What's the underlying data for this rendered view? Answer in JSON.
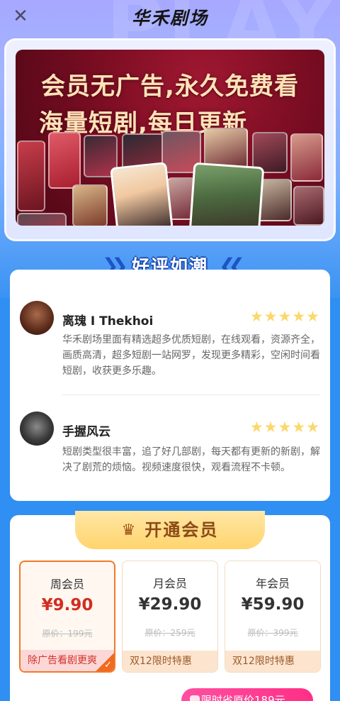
{
  "header": {
    "title": "华禾剧场",
    "close_icon": "close-icon"
  },
  "banner": {
    "line1": "会员无广告,永久免费看",
    "line2": "海量短剧,每日更新"
  },
  "reviews_section": {
    "title": "好评如潮",
    "items": [
      {
        "name": "离瑰 I Thekhoi",
        "stars": "★★★★★",
        "text": "华禾剧场里面有精选超多优质短剧，在线观看，资源齐全，画质高清，超多短剧一站网罗，发现更多精彩，空闲时间看短剧，收获更多乐趣。"
      },
      {
        "name": "手握风云",
        "stars": "★★★★★",
        "text": "短剧类型很丰富，追了好几部剧，每天都有更新的新剧，解决了剧荒的烦恼。视频速度很快，观看流程不卡顿。"
      }
    ]
  },
  "membership": {
    "title": "开通会员",
    "plans": [
      {
        "name": "周会员",
        "price": "¥9.90",
        "original": "原价：199元",
        "promo": "除广告看剧更爽",
        "selected": true
      },
      {
        "name": "月会员",
        "price": "¥29.90",
        "original": "原价：259元",
        "promo": "双12限时特惠",
        "selected": false
      },
      {
        "name": "年会员",
        "price": "¥59.90",
        "original": "原价：399元",
        "promo": "双12限时特惠",
        "selected": false
      }
    ],
    "float_tag": "限时省原价189元"
  },
  "colors": {
    "accent_red": "#d22d21",
    "accent_orange": "#f07a2a",
    "star_yellow": "#fbd86b",
    "page_blue": "#2f8ff2"
  }
}
